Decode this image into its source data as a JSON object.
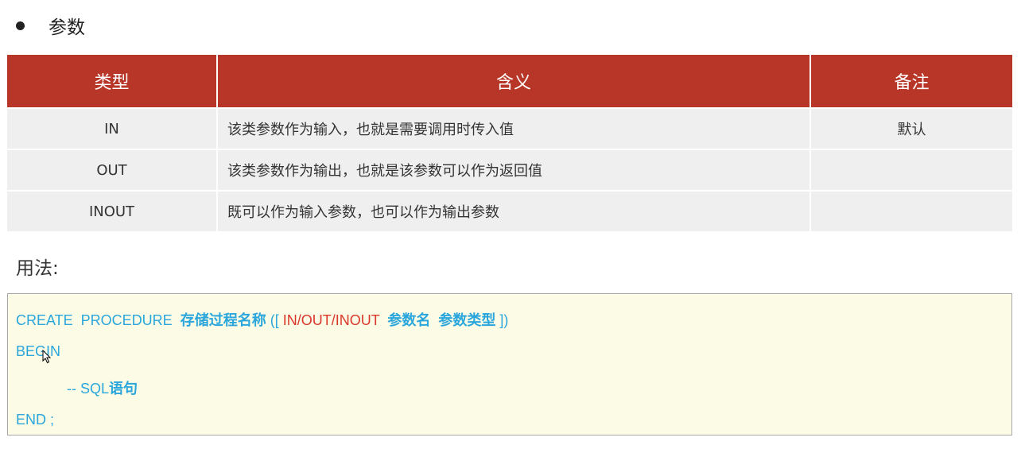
{
  "section": {
    "title": "参数"
  },
  "table": {
    "headers": [
      "类型",
      "含义",
      "备注"
    ],
    "rows": [
      [
        "IN",
        "该类参数作为输入，也就是需要调用时传入值",
        "默认"
      ],
      [
        "OUT",
        "该类参数作为输出，也就是该参数可以作为返回值",
        ""
      ],
      [
        "INOUT",
        "既可以作为输入参数，也可以作为输出参数",
        ""
      ]
    ]
  },
  "usage": {
    "title": "用法:",
    "code": {
      "line1": {
        "create": "CREATE  PROCEDURE  ",
        "name": "存储过程名称",
        "open": " ([ ",
        "mode": "IN/OUT/INOUT",
        "space": "  ",
        "param_name": "参数名",
        "space2": "  ",
        "param_type": "参数类型",
        "close": " ])"
      },
      "line2": "BEGIN",
      "line3": {
        "prefix": "-- SQL",
        "suffix": "语句"
      },
      "line4": "END ;"
    }
  },
  "colors": {
    "header_bg": "#b83627",
    "row_bg": "#efefef",
    "code_bg": "#fcfbe6",
    "code_text": "#2aa6dc",
    "code_highlight": "#d9392b"
  },
  "icons": {
    "cursor": "mouse-pointer-icon"
  }
}
